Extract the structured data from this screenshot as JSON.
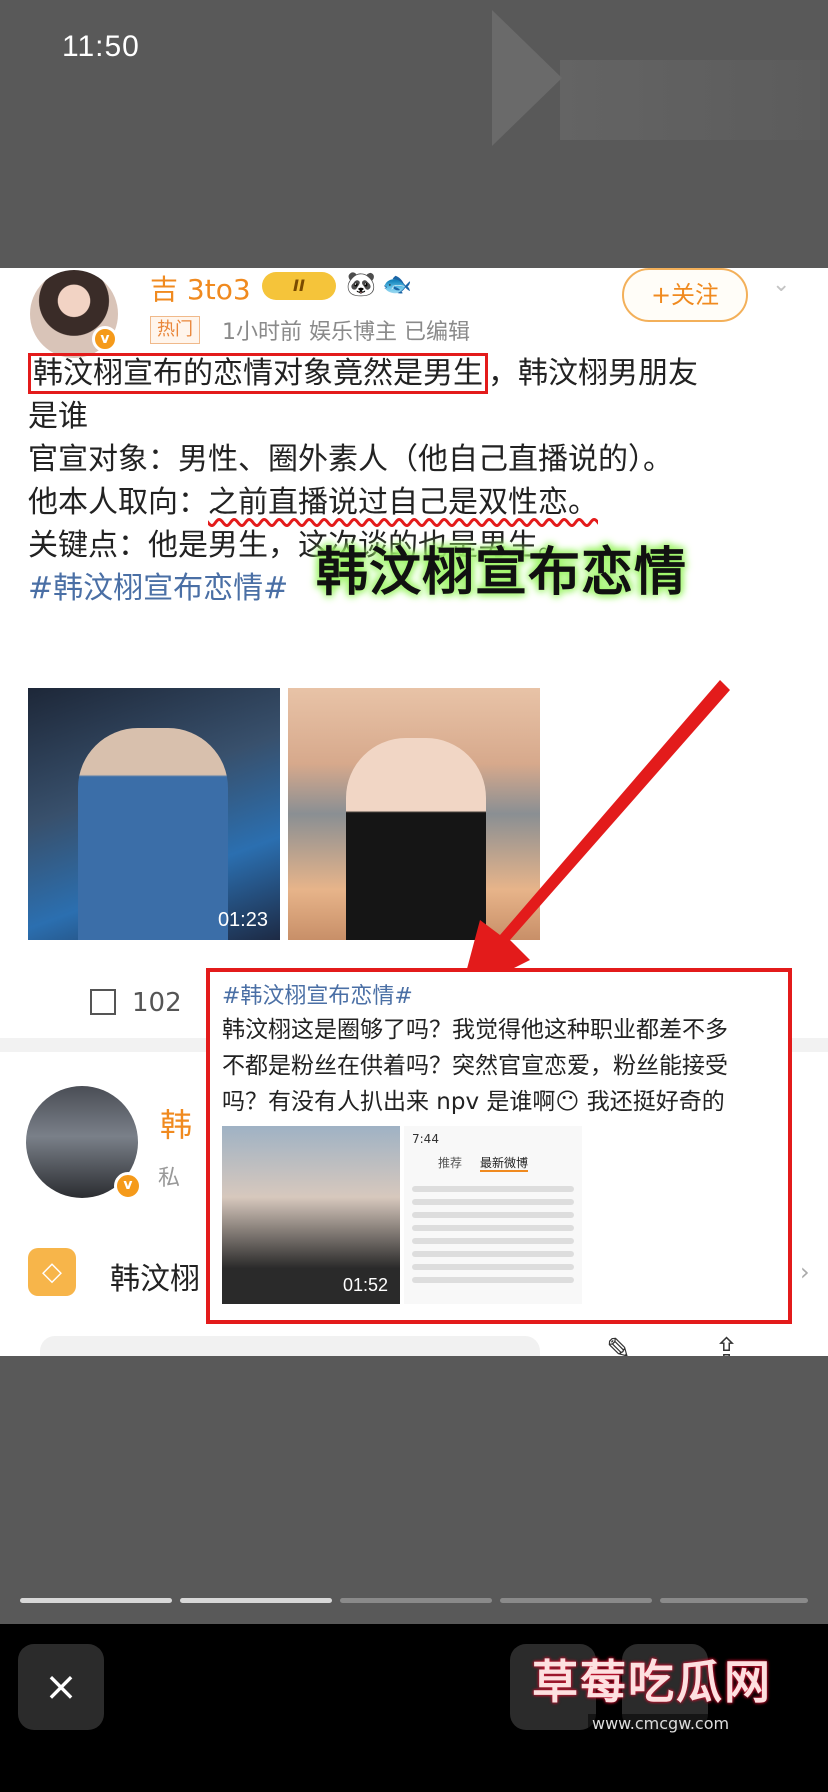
{
  "status": {
    "time": "11:50"
  },
  "post": {
    "author": "吉 3to3",
    "crown_label": "II",
    "hot_tag": "热门",
    "meta": "1小时前  娱乐博主  已编辑",
    "follow_label": "+关注",
    "line1_highlight": "韩汶栩宣布的恋情对象竟然是男生",
    "line1_rest": "，韩汶栩男朋友",
    "line2": "是谁",
    "line3": "官宣对象：男性、圈外素人（他自己直播说的）。",
    "line4_prefix": "他本人取向：",
    "line4_wavy": "之前直播说过自己是双性恋。",
    "line5": "关键点：他是男生，这次谈的也是男生。",
    "hashtag": "#韩汶栩宣布恋情#",
    "big_caption": "韩汶栩宣布恋情",
    "video1_duration": "01:23",
    "share_count": "102"
  },
  "second_post": {
    "author_partial": "韩",
    "sub_partial": "私",
    "row_text": "韩汶栩"
  },
  "overlay": {
    "hashtag": "#韩汶栩宣布恋情#",
    "line1": "韩汶栩这是圈够了吗？我觉得他这种职业都差不多",
    "line2": "不都是粉丝在供着吗？突然官宣恋爱，粉丝能接受",
    "line3": "吗？有没有人扒出来 npv 是谁啊😶 我还挺好奇的",
    "video_duration": "01:52",
    "mini_time": "7:44",
    "mini_tab1": "推荐",
    "mini_tab2": "最新微博"
  },
  "progress": {
    "segments": 5,
    "current": 2
  },
  "footer": {
    "close_icon": "×",
    "watermark": "草莓吃瓜网",
    "watermark_url": "www.cmcgw.com"
  },
  "colors": {
    "accent": "#f08a1f",
    "highlight": "#e31b1b",
    "hashtag": "#4a6fa5",
    "glow": "#9ff56a"
  }
}
